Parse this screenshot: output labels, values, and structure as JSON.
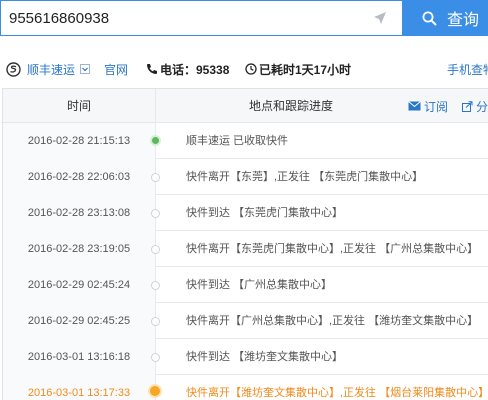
{
  "search": {
    "value": "955616860938",
    "button_label": "查询"
  },
  "info": {
    "company": "顺丰速运",
    "official_link": "官网",
    "phone": "电话：95338",
    "elapsed": "已耗时1天17小时",
    "mobile_link": "手机查物流"
  },
  "table": {
    "col_time": "时间",
    "col_place": "地点和跟踪进度",
    "subscribe": "订阅",
    "share": "分享",
    "rows": [
      {
        "time": "2016-02-28 21:15:13",
        "desc": "顺丰速运 已收取快件"
      },
      {
        "time": "2016-02-28 22:06:03",
        "desc": "快件离开【东莞】,正发往 【东莞虎门集散中心】"
      },
      {
        "time": "2016-02-28 23:13:08",
        "desc": "快件到达 【东莞虎门集散中心】"
      },
      {
        "time": "2016-02-28 23:19:05",
        "desc": "快件离开【东莞虎门集散中心】,正发往 【广州总集散中心】"
      },
      {
        "time": "2016-02-29 02:45:24",
        "desc": "快件到达 【广州总集散中心】"
      },
      {
        "time": "2016-02-29 02:45:25",
        "desc": "快件离开【广州总集散中心】,正发往 【潍坊奎文集散中心】"
      },
      {
        "time": "2016-03-01 13:16:18",
        "desc": "快件到达 【潍坊奎文集散中心】"
      },
      {
        "time": "2016-03-01 13:17:33",
        "desc": "快件离开【潍坊奎文集散中心】,正发往 【烟台莱阳集散中心】"
      }
    ]
  },
  "colors": {
    "accent": "#3a8ee6",
    "link": "#2a77c9",
    "active": "#f28a1b",
    "first_dot": "#5cb85c"
  }
}
